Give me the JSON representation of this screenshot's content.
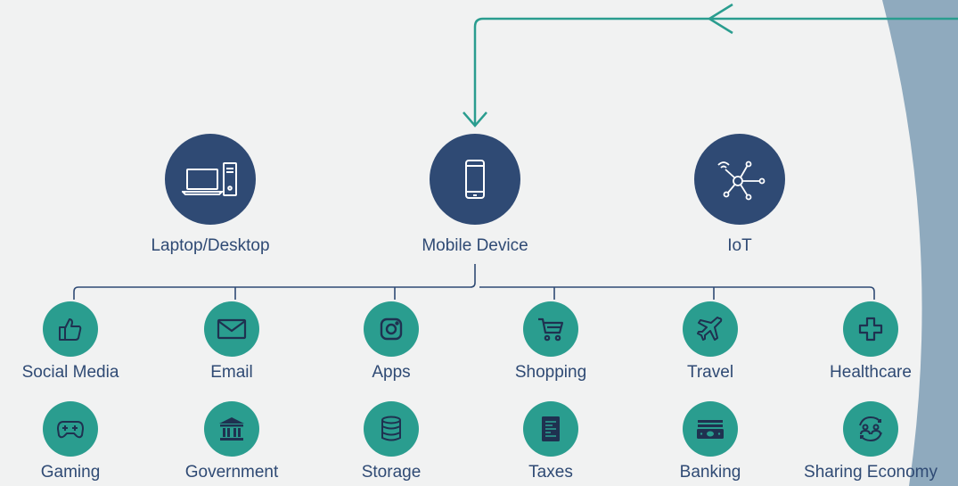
{
  "colors": {
    "navy": "#2f4a74",
    "teal": "#2a9d8f",
    "background": "#f1f2f2",
    "accent_arc": "#7e9db5"
  },
  "devices": [
    {
      "label": "Laptop/Desktop",
      "icon": "laptop-desktop-icon"
    },
    {
      "label": "Mobile Device",
      "icon": "mobile-phone-icon"
    },
    {
      "label": "IoT",
      "icon": "iot-network-icon"
    }
  ],
  "services_row1": [
    {
      "label": "Social Media",
      "icon": "thumbs-up-icon"
    },
    {
      "label": "Email",
      "icon": "envelope-icon"
    },
    {
      "label": "Apps",
      "icon": "instagram-icon"
    },
    {
      "label": "Shopping",
      "icon": "shopping-cart-icon"
    },
    {
      "label": "Travel",
      "icon": "airplane-icon"
    },
    {
      "label": "Healthcare",
      "icon": "medical-cross-icon"
    }
  ],
  "services_row2": [
    {
      "label": "Gaming",
      "icon": "gamepad-icon"
    },
    {
      "label": "Government",
      "icon": "government-building-icon"
    },
    {
      "label": "Storage",
      "icon": "database-icon"
    },
    {
      "label": "Taxes",
      "icon": "tax-document-icon"
    },
    {
      "label": "Banking",
      "icon": "cash-stack-icon"
    },
    {
      "label": "Sharing Economy",
      "icon": "people-exchange-icon"
    }
  ]
}
